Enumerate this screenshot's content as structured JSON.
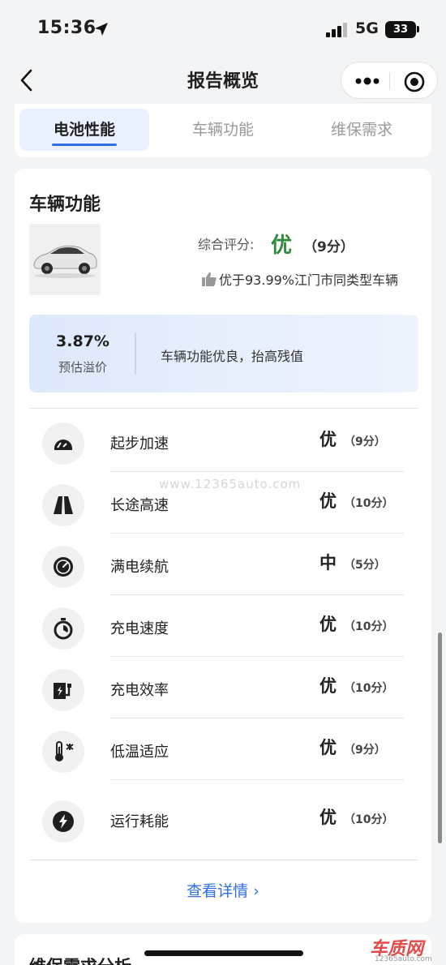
{
  "status_bar": {
    "time": "15:36",
    "network": "5G",
    "battery": "33"
  },
  "nav": {
    "title": "报告概览"
  },
  "tabs": [
    {
      "label": "电池性能",
      "active": true
    },
    {
      "label": "车辆功能",
      "active": false
    },
    {
      "label": "维保需求",
      "active": false
    }
  ],
  "section": {
    "title": "车辆功能",
    "score_label": "综合评分:",
    "score_grade": "优",
    "score_points": "（9分）",
    "compare_text": "优于93.99%江门市同类型车辆"
  },
  "premium": {
    "value": "3.87%",
    "label": "预估溢价",
    "description": "车辆功能优良，抬高残值"
  },
  "metrics": [
    {
      "name": "起步加速",
      "grade": "优",
      "points": "（9分）",
      "icon": "speedometer-icon"
    },
    {
      "name": "长途高速",
      "grade": "优",
      "points": "（10分）",
      "icon": "highway-icon"
    },
    {
      "name": "满电续航",
      "grade": "中",
      "points": "（5分）",
      "icon": "range-gauge-icon"
    },
    {
      "name": "充电速度",
      "grade": "优",
      "points": "（10分）",
      "icon": "stopwatch-icon"
    },
    {
      "name": "充电效率",
      "grade": "优",
      "points": "（10分）",
      "icon": "charger-icon"
    },
    {
      "name": "低温适应",
      "grade": "优",
      "points": "（9分）",
      "icon": "thermometer-icon"
    },
    {
      "name": "运行耗能",
      "grade": "优",
      "points": "（10分）",
      "icon": "lightning-icon"
    }
  ],
  "watermark": "www.12365auto.com",
  "details_link": "查看详情 ›",
  "next_section_title": "维保需求分析",
  "brand": {
    "name": "车质网",
    "url": "12365auto.com"
  },
  "colors": {
    "accent": "#2f6fe5",
    "good": "#2f8a3a",
    "premium_bg": "#e3ecfc"
  }
}
